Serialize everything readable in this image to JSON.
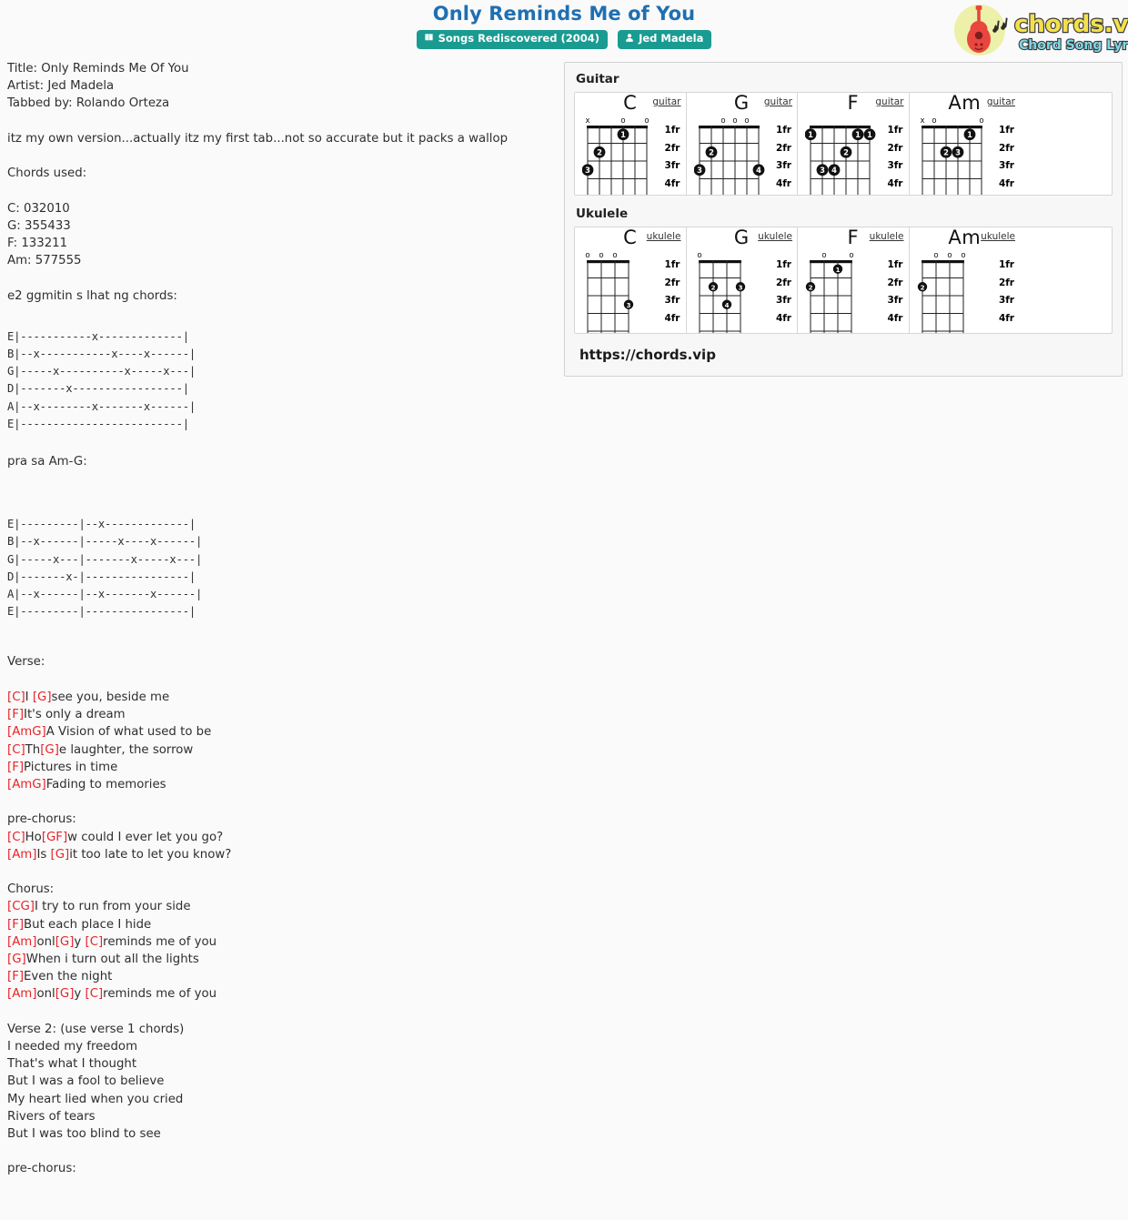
{
  "header": {
    "title": "Only Reminds Me of You",
    "badges": [
      {
        "icon": "book-icon",
        "label": "Songs Rediscovered (2004)"
      },
      {
        "icon": "user-icon",
        "label": "Jed Madela"
      }
    ],
    "logo": {
      "brand": "chords.vip",
      "tagline": "Chord Song Lyric"
    }
  },
  "tab": {
    "header_lines": [
      "Title: Only Reminds Me Of You",
      "Artist: Jed Madela",
      "Tabbed by: Rolando Orteza",
      "",
      "itz my own version...actually itz my first tab...not so accurate but it packs a wallop",
      "",
      "Chords used:",
      "",
      "C: 032010",
      "G: 355433",
      "F: 133211",
      "Am: 577555",
      "",
      "e2 ggmitin s lhat ng chords:"
    ],
    "tab_block_1": "E|-----------x-------------|\nB|--x-----------x----x------|\nG|-----x----------x-----x---|\nD|-------x-----------------|\nA|--x--------x-------x------|\nE|-------------------------|",
    "label_pra": "pra sa Am-G:",
    "tab_block_2": "E|---------|--x-------------|\nB|--x------|-----x----x------|\nG|-----x---|-------x-----x---|\nD|-------x-|----------------|\nA|--x------|--x-------x------|\nE|---------|----------------|",
    "sections": [
      {
        "type": "plain",
        "text": "Verse:"
      },
      {
        "type": "blank",
        "text": ""
      },
      {
        "type": "lyric",
        "parts": [
          {
            "c": "[C]"
          },
          {
            "t": "I "
          },
          {
            "c": "[G]"
          },
          {
            "t": "see you, beside me"
          }
        ]
      },
      {
        "type": "lyric",
        "parts": [
          {
            "c": "[F]"
          },
          {
            "t": "It's only a dream"
          }
        ]
      },
      {
        "type": "lyric",
        "parts": [
          {
            "c": "[AmG]"
          },
          {
            "t": "A Vision of what used to be"
          }
        ]
      },
      {
        "type": "lyric",
        "parts": [
          {
            "c": "[C]"
          },
          {
            "t": "Th"
          },
          {
            "c": "[G]"
          },
          {
            "t": "e laughter, the sorrow"
          }
        ]
      },
      {
        "type": "lyric",
        "parts": [
          {
            "c": "[F]"
          },
          {
            "t": "Pictures in time"
          }
        ]
      },
      {
        "type": "lyric",
        "parts": [
          {
            "c": "[AmG]"
          },
          {
            "t": "Fading to memories"
          }
        ]
      },
      {
        "type": "blank",
        "text": ""
      },
      {
        "type": "plain",
        "text": "pre-chorus:"
      },
      {
        "type": "lyric",
        "parts": [
          {
            "c": "[C]"
          },
          {
            "t": "Ho"
          },
          {
            "c": "[GF]"
          },
          {
            "t": "w could I ever let you go?"
          }
        ]
      },
      {
        "type": "lyric",
        "parts": [
          {
            "c": "[Am]"
          },
          {
            "t": "Is "
          },
          {
            "c": "[G]"
          },
          {
            "t": "it too late to let you know?"
          }
        ]
      },
      {
        "type": "blank",
        "text": ""
      },
      {
        "type": "plain",
        "text": "Chorus:"
      },
      {
        "type": "lyric",
        "parts": [
          {
            "c": "[CG]"
          },
          {
            "t": "I try to run from your side"
          }
        ]
      },
      {
        "type": "lyric",
        "parts": [
          {
            "c": "[F]"
          },
          {
            "t": "But each place I hide"
          }
        ]
      },
      {
        "type": "lyric",
        "parts": [
          {
            "c": "[Am]"
          },
          {
            "t": "onl"
          },
          {
            "c": "[G]"
          },
          {
            "t": "y "
          },
          {
            "c": "[C]"
          },
          {
            "t": "reminds me of you"
          }
        ]
      },
      {
        "type": "lyric",
        "parts": [
          {
            "c": "[G]"
          },
          {
            "t": "When i turn out all the lights"
          }
        ]
      },
      {
        "type": "lyric",
        "parts": [
          {
            "c": "[F]"
          },
          {
            "t": "Even the night"
          }
        ]
      },
      {
        "type": "lyric",
        "parts": [
          {
            "c": "[Am]"
          },
          {
            "t": "onl"
          },
          {
            "c": "[G]"
          },
          {
            "t": "y "
          },
          {
            "c": "[C]"
          },
          {
            "t": "reminds me of you"
          }
        ]
      },
      {
        "type": "blank",
        "text": ""
      },
      {
        "type": "plain",
        "text": "Verse 2: (use verse 1 chords)"
      },
      {
        "type": "plain",
        "text": "I needed my freedom"
      },
      {
        "type": "plain",
        "text": "That's what I thought"
      },
      {
        "type": "plain",
        "text": "But I was a fool to believe"
      },
      {
        "type": "plain",
        "text": "My heart lied when you cried"
      },
      {
        "type": "plain",
        "text": "Rivers of tears"
      },
      {
        "type": "plain",
        "text": "But I was too blind to see"
      },
      {
        "type": "blank",
        "text": ""
      },
      {
        "type": "plain",
        "text": "pre-chorus:"
      }
    ]
  },
  "chords": {
    "guitar_label": "Guitar",
    "ukulele_label": "Ukulele",
    "fret_labels": [
      "1fr",
      "2fr",
      "3fr",
      "4fr"
    ],
    "guitar_tag": "guitar",
    "ukulele_tag": "ukulele",
    "url": "https://chords.vip",
    "guitar": [
      {
        "name": "C",
        "open_marks": [
          "x",
          "",
          "",
          "o",
          "",
          "o"
        ],
        "dots": [
          {
            "string": 4,
            "fret": 1,
            "finger": "1"
          },
          {
            "string": 2,
            "fret": 2,
            "finger": "2"
          },
          {
            "string": 1,
            "fret": 3,
            "finger": "3"
          }
        ]
      },
      {
        "name": "G",
        "open_marks": [
          "",
          "",
          "o",
          "o",
          "o",
          ""
        ],
        "dots": [
          {
            "string": 1,
            "fret": 3,
            "finger": "3"
          },
          {
            "string": 2,
            "fret": 2,
            "finger": "2"
          },
          {
            "string": 6,
            "fret": 3,
            "finger": "4"
          }
        ]
      },
      {
        "name": "F",
        "open_marks": [
          "",
          "",
          "",
          "",
          "",
          ""
        ],
        "dots": [
          {
            "string": 1,
            "fret": 1,
            "finger": "1"
          },
          {
            "string": 5,
            "fret": 1,
            "finger": "1"
          },
          {
            "string": 6,
            "fret": 1,
            "finger": "1"
          },
          {
            "string": 4,
            "fret": 2,
            "finger": "2"
          },
          {
            "string": 2,
            "fret": 3,
            "finger": "3"
          },
          {
            "string": 3,
            "fret": 3,
            "finger": "4"
          }
        ]
      },
      {
        "name": "Am",
        "open_marks": [
          "x",
          "o",
          "",
          "",
          "",
          "o"
        ],
        "dots": [
          {
            "string": 5,
            "fret": 1,
            "finger": "1"
          },
          {
            "string": 3,
            "fret": 2,
            "finger": "2"
          },
          {
            "string": 4,
            "fret": 2,
            "finger": "3"
          }
        ]
      }
    ],
    "ukulele": [
      {
        "name": "C",
        "open_marks": [
          "o",
          "o",
          "o",
          ""
        ],
        "dots": [
          {
            "string": 4,
            "fret": 3,
            "finger": "3"
          }
        ]
      },
      {
        "name": "G",
        "open_marks": [
          "o",
          "",
          "",
          ""
        ],
        "dots": [
          {
            "string": 2,
            "fret": 2,
            "finger": "2"
          },
          {
            "string": 4,
            "fret": 2,
            "finger": "3"
          },
          {
            "string": 3,
            "fret": 3,
            "finger": "4"
          }
        ]
      },
      {
        "name": "F",
        "open_marks": [
          "",
          "o",
          "",
          "o"
        ],
        "dots": [
          {
            "string": 3,
            "fret": 1,
            "finger": "1"
          },
          {
            "string": 1,
            "fret": 2,
            "finger": "2"
          }
        ]
      },
      {
        "name": "Am",
        "open_marks": [
          "",
          "o",
          "o",
          "o"
        ],
        "dots": [
          {
            "string": 1,
            "fret": 2,
            "finger": "2"
          }
        ]
      }
    ]
  }
}
